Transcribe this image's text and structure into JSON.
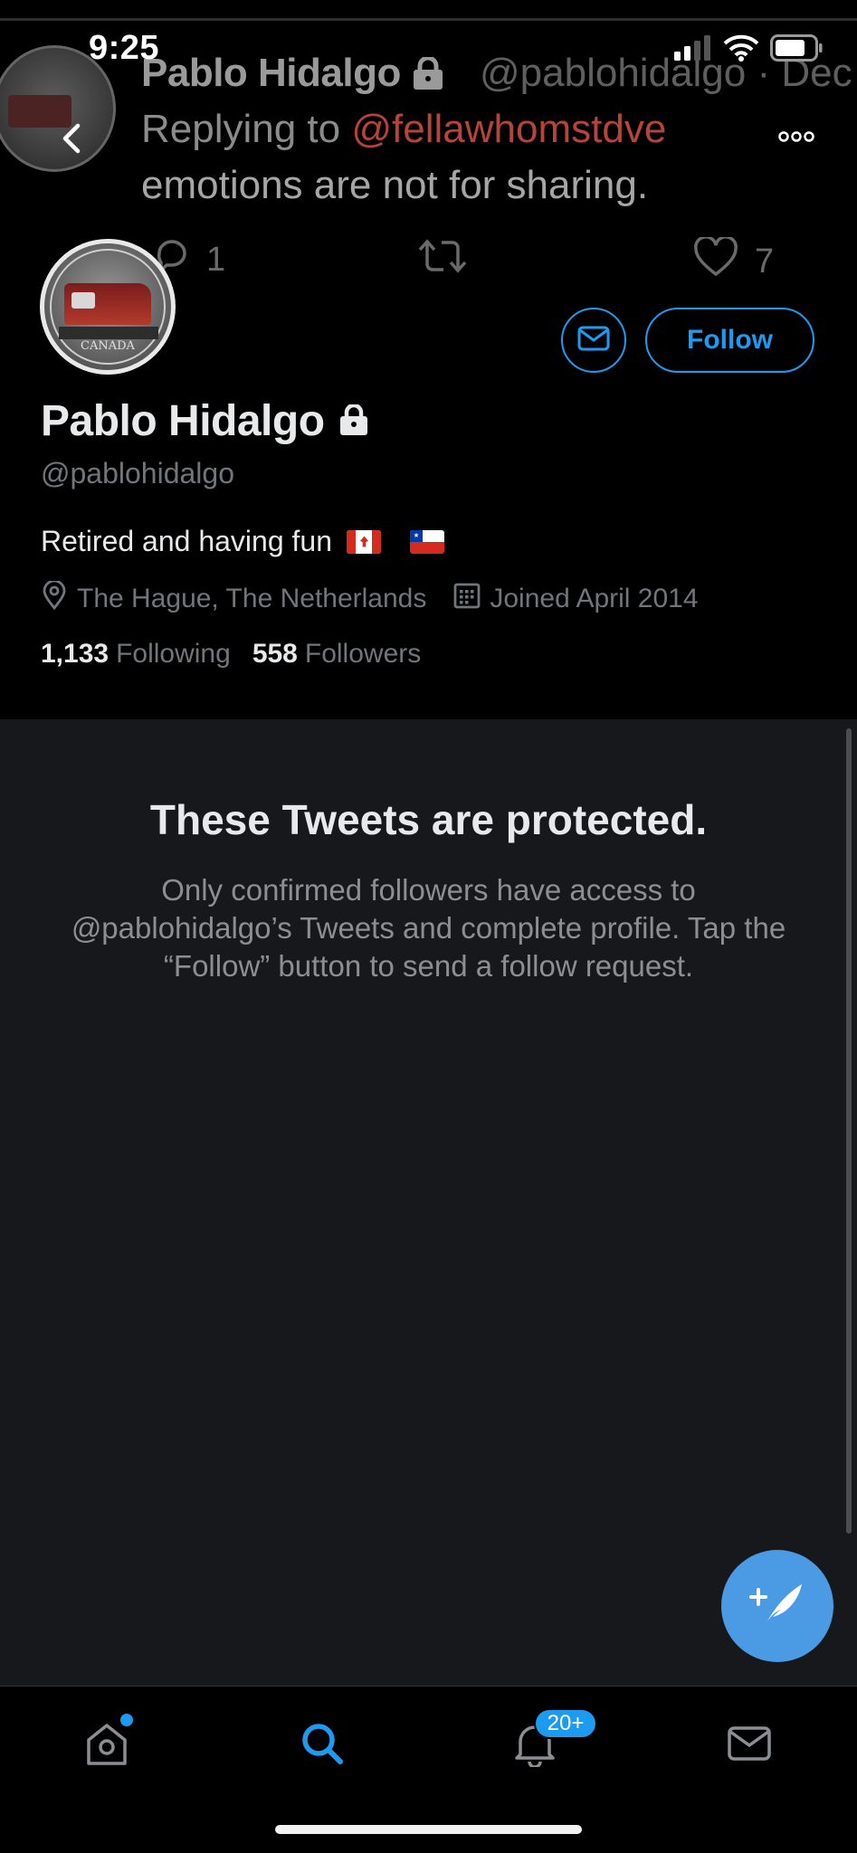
{
  "status_bar": {
    "time": "9:25"
  },
  "banner": {
    "name": "Pablo Hidalgo",
    "handle": "@pablohidalgo · Dec",
    "reply_prefix": "Replying to",
    "reply_mention": "@fellawhomstdve",
    "tweet_text": "emotions are not for sharing.",
    "reply_count": "1",
    "like_count": "7"
  },
  "profile": {
    "name": "Pablo Hidalgo",
    "handle": "@pablohidalgo",
    "bio": "Retired and having fun",
    "location": "The Hague, The Netherlands",
    "joined": "Joined April 2014",
    "following_count": "1,133",
    "following_label": "Following",
    "followers_count": "558",
    "followers_label": "Followers",
    "follow_label": "Follow",
    "avatar_text": "CANADA"
  },
  "protected": {
    "title": "These Tweets are protected.",
    "description": "Only confirmed followers have access to @pablohidalgo’s Tweets and complete profile. Tap the “Follow” button to send a follow request."
  },
  "tabbar": {
    "notifications_badge": "20+"
  },
  "colors": {
    "accent": "#1d9bf0",
    "fab": "#4a9ae4",
    "panel_bg": "#16181c",
    "muted": "#71767b"
  }
}
